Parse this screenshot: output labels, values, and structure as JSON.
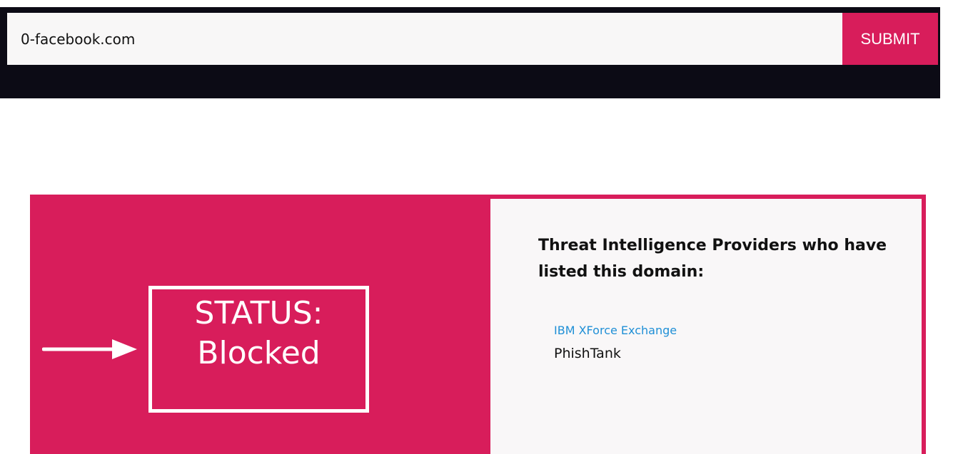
{
  "search": {
    "value": "0-facebook.com",
    "submit_label": "SUBMIT"
  },
  "status": {
    "line1": "STATUS:",
    "line2": "Blocked"
  },
  "providers": {
    "title": "Threat Intelligence Providers who have listed this domain:",
    "items": [
      {
        "label": "IBM XForce Exchange",
        "is_link": true
      },
      {
        "label": "PhishTank",
        "is_link": false
      }
    ]
  },
  "colors": {
    "accent": "#d81d5b",
    "header_bg": "#0c0b15",
    "link": "#1f8fd6"
  }
}
